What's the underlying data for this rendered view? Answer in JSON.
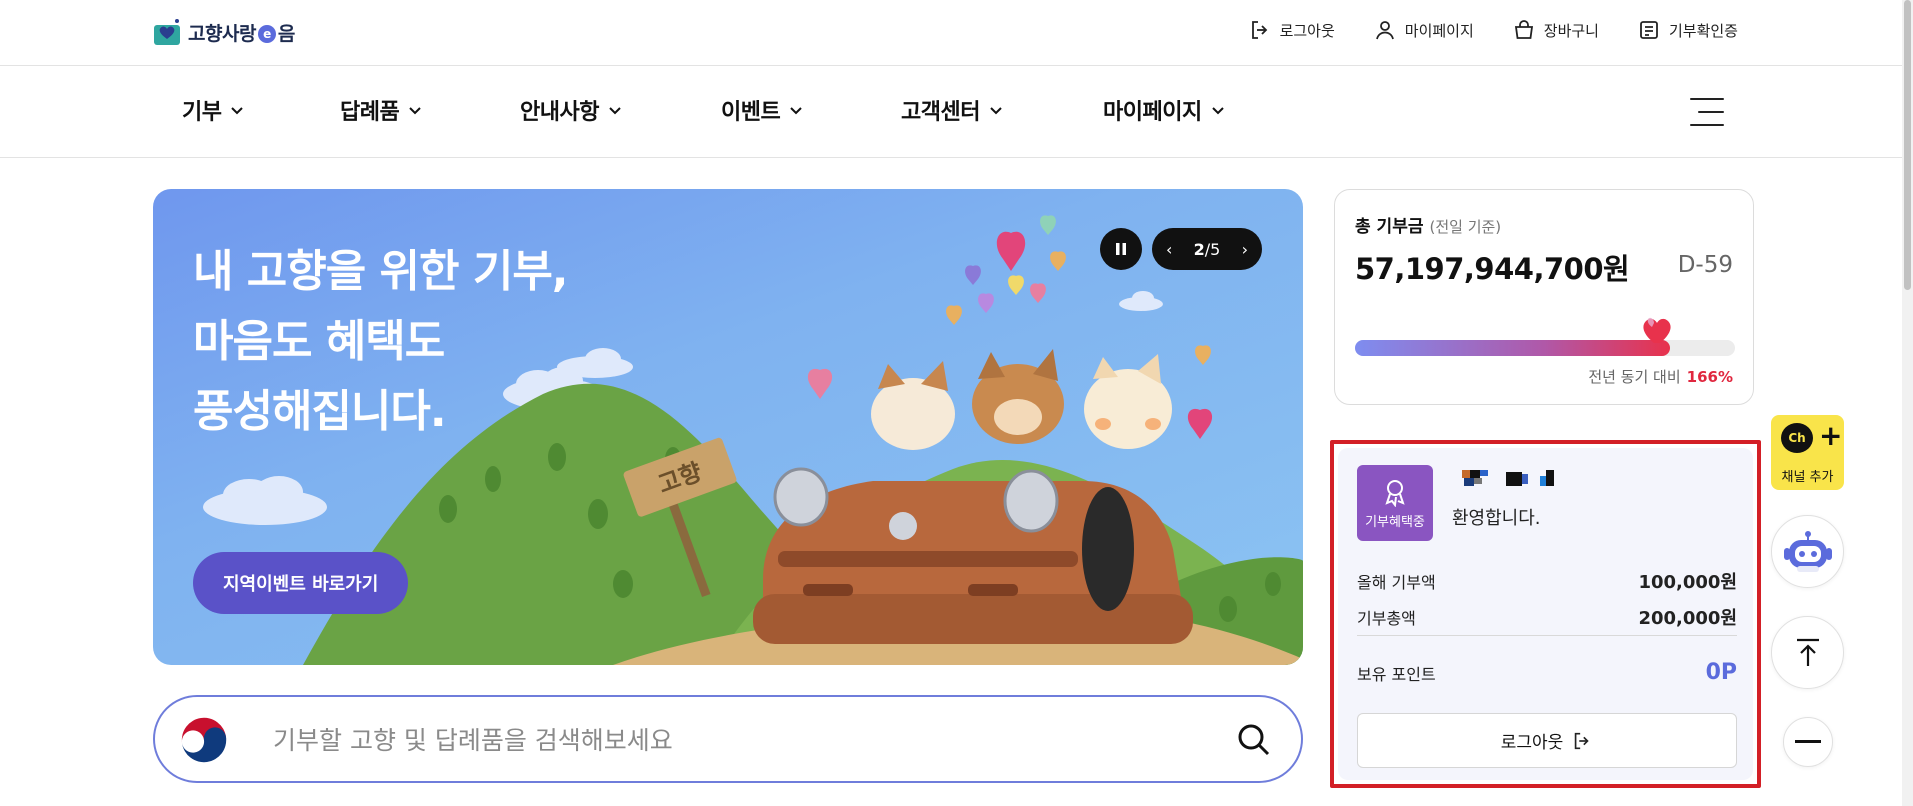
{
  "header": {
    "logo_text_a": "고향사랑",
    "logo_text_dot": "e",
    "logo_text_b": "음",
    "links": [
      {
        "label": "로그아웃",
        "icon": "logout-icon"
      },
      {
        "label": "마이페이지",
        "icon": "user-icon"
      },
      {
        "label": "장바구니",
        "icon": "cart-icon"
      },
      {
        "label": "기부확인증",
        "icon": "certificate-icon"
      }
    ]
  },
  "nav": {
    "items": [
      "기부",
      "답례품",
      "안내사항",
      "이벤트",
      "고객센터",
      "마이페이지"
    ],
    "menu_icon": "hamburger-icon"
  },
  "banner": {
    "title_line1": "내 고향을 위한 기부,",
    "title_line2": "마음도 혜택도",
    "title_line3": "풍성해집니다.",
    "button_label": "지역이벤트 바로가기",
    "sign_text": "고향",
    "page_current": "2",
    "page_total": "/5",
    "prev_icon": "chevron-left-icon",
    "next_icon": "chevron-right-icon",
    "pause_icon": "pause-icon"
  },
  "search": {
    "placeholder": "기부할 고향 및 답례품을 검색해보세요",
    "value": ""
  },
  "total": {
    "label": "총 기부금",
    "basis": "(전일 기준)",
    "amount": "57,197,944,700원",
    "dday": "D-59",
    "progress": 0.83,
    "compare_label": "전년 동기 대비",
    "compare_value": "166%"
  },
  "user": {
    "badge_label": "기부혜택중",
    "welcome": "환영합니다.",
    "rows": [
      {
        "label": "올해 기부액",
        "value": "100,000원"
      },
      {
        "label": "기부총액",
        "value": "200,000원"
      }
    ],
    "points_label": "보유 포인트",
    "points_value": "0P",
    "logout_label": "로그아웃"
  },
  "side": {
    "kakao_icon_text": "Ch",
    "kakao_plus": "+",
    "kakao_label": "채널 추가",
    "chatbot_icon": "robot-icon",
    "top_icon": "scroll-top-icon",
    "minimize_icon": "minus-icon"
  },
  "colors": {
    "accent": "#5b6bdc",
    "banner_button": "#5a52c8",
    "badge": "#8a55c1",
    "highlight_box": "#d31f26",
    "compare": "#e0273f",
    "kakao": "#f9e44a"
  }
}
